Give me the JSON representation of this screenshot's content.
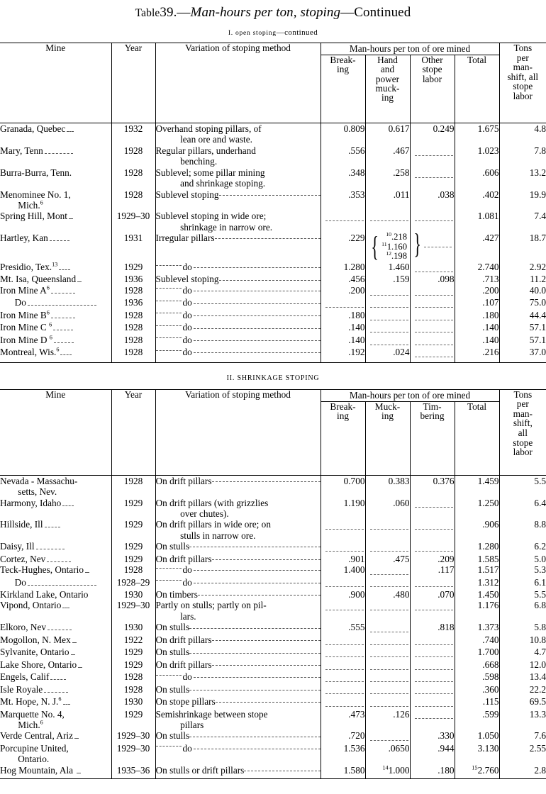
{
  "title": {
    "label_small": "Table",
    "number": "39.—",
    "italic_part": "Man-hours per ton, stoping",
    "suffix": "—Continued"
  },
  "section1": {
    "heading_numeral": "I.",
    "heading_smallcaps": "open stoping",
    "heading_suffix": "—continued"
  },
  "section2": {
    "heading": "II.  SHRINKAGE STOPING"
  },
  "table1": {
    "headers": {
      "mine": "Mine",
      "year": "Year",
      "method": "Variation of stoping method",
      "group": "Man-hours per ton of ore mined",
      "breaking": "Break-\ning",
      "mucking": "Hand\nand\npower\nmuck-\ning",
      "other": "Other\nstope\nlabor",
      "total": "Total",
      "tons": "Tons\nper\nman-\nshift, all\nstope\nlabor"
    },
    "rows": [
      {
        "mine": "Granada, Quebec",
        "mine_leader": true,
        "year": "1932",
        "method": "Overhand stoping pillars, of",
        "method2": "lean ore and waste.",
        "breaking": "0.809",
        "mucking": "0.617",
        "other": "0.249",
        "total": "1.675",
        "tons": "4.8"
      },
      {
        "mine": "Mary, Tenn",
        "mine_leader": true,
        "year": "1928",
        "method": "Regular    pillars,    underhand",
        "method2": "benching.",
        "breaking": ".556",
        "mucking": ".467",
        "other": "",
        "other_dash": true,
        "total": "1.023",
        "tons": "7.8"
      },
      {
        "mine": "Burra-Burra,  Tenn.",
        "mine_leader": false,
        "year": "1928",
        "method": "Sublevel; some pillar mining",
        "method2": "and shrinkage stoping.",
        "breaking": ".348",
        "mucking": ".258",
        "other": "",
        "other_dash": true,
        "total": ".606",
        "tons": "13.2"
      },
      {
        "mine": "Menominee   No.   1,",
        "mine2": "Mich.",
        "mine2_sup": "6",
        "mine_leader": false,
        "year": "1928",
        "method": "Sublevel stoping",
        "method_leader": true,
        "breaking": ".353",
        "mucking": ".011",
        "other": ".038",
        "total": ".402",
        "tons": "19.9"
      },
      {
        "mine": "Spring Hill, Mont",
        "mine_leader": true,
        "year": "1929–30",
        "method": "Sublevel stoping in wide ore;",
        "method2": "shrinkage in narrow ore.",
        "breaking": "",
        "breaking_dash": true,
        "mucking": "",
        "mucking_dash": true,
        "other": "",
        "other_dash": true,
        "total": "1.081",
        "tons": "7.4"
      },
      {
        "mine": "Hartley, Kan",
        "mine_leader": true,
        "year": "1931",
        "method": "Irregular pillars",
        "method_leader": true,
        "breaking": ".229",
        "brace": {
          "v1": ".218",
          "s1": "10",
          "v2": "1.160",
          "s2": "11",
          "v3": ".198",
          "s3": "12"
        },
        "other": "",
        "other_dash": true,
        "total": ".427",
        "tons": "18.7"
      },
      {
        "mine": "Presidio, Tex.",
        "mine_sup": "13",
        "mine_leader": true,
        "year": "1929",
        "method": "do",
        "method_do": true,
        "breaking": "1.280",
        "mucking": "1.460",
        "other": "",
        "other_dash": true,
        "total": "2.740",
        "tons": "2.92"
      },
      {
        "mine": "Mt. Isa, Queensland",
        "mine_leader": true,
        "year": "1936",
        "method": "Sublevel stoping",
        "method_leader": true,
        "breaking": ".456",
        "mucking": ".159",
        "other": ".098",
        "total": ".713",
        "tons": "11.2"
      },
      {
        "mine": "Iron Mine A",
        "mine_sup": "6",
        "mine_leader": true,
        "year": "1928",
        "method": "do",
        "method_do": true,
        "breaking": ".200",
        "mucking": "",
        "mucking_dash": true,
        "other": "",
        "other_dash": true,
        "total": ".200",
        "tons": "40.0"
      },
      {
        "mine": "Do",
        "mine_center": true,
        "mine_leader": true,
        "year": "1936",
        "method": "do",
        "method_do": true,
        "breaking": "",
        "breaking_dash": true,
        "mucking": "",
        "mucking_dash": true,
        "other": "",
        "other_dash": true,
        "total": ".107",
        "tons": "75.0"
      },
      {
        "mine": "Iron Mine B",
        "mine_sup": "6",
        "mine_leader": true,
        "year": "1928",
        "method": "do",
        "method_do": true,
        "breaking": ".180",
        "mucking": "",
        "mucking_dash": true,
        "other": "",
        "other_dash": true,
        "total": ".180",
        "tons": "44.4"
      },
      {
        "mine": "Iron Mine C ",
        "mine_sup": "6",
        "mine_leader": true,
        "year": "1928",
        "method": "do",
        "method_do": true,
        "breaking": ".140",
        "mucking": "",
        "mucking_dash": true,
        "other": "",
        "other_dash": true,
        "total": ".140",
        "tons": "57.1"
      },
      {
        "mine": "Iron Mine D ",
        "mine_sup": "6",
        "mine_leader": true,
        "year": "1928",
        "method": "do",
        "method_do": true,
        "breaking": ".140",
        "mucking": "",
        "mucking_dash": true,
        "other": "",
        "other_dash": true,
        "total": ".140",
        "tons": "57.1"
      },
      {
        "mine": "Montreal, Wis.",
        "mine_sup": "6",
        "mine_leader": true,
        "year": "1928",
        "method": "do",
        "method_do": true,
        "breaking": ".192",
        "mucking": ".024",
        "other": "",
        "other_dash": true,
        "total": ".216",
        "tons": "37.0"
      }
    ]
  },
  "table2": {
    "headers": {
      "mine": "Mine",
      "year": "Year",
      "method": "Variation of stoping method",
      "group": "Man-hours per ton of ore mined",
      "breaking": "Break-\ning",
      "mucking": "Muck-\ning",
      "timbering": "Tim-\nbering",
      "total": "Total",
      "tons": "Tons\nper\nman-\nshift,\nall\nstope\nlabor"
    },
    "rows": [
      {
        "mine": "Nevada - Massachu-",
        "mine2": "setts, Nev.",
        "year": "1928",
        "method": "On drift pillars",
        "method_leader": true,
        "breaking": "0.700",
        "mucking": "0.383",
        "timbering": "0.376",
        "total": "1.459",
        "tons": "5.5"
      },
      {
        "mine": "Harmony, Idaho",
        "mine_leader": true,
        "year": "1929",
        "method": "On drift pillars (with grizzlies",
        "method2": "over chutes).",
        "breaking": "1.190",
        "mucking": ".060",
        "timbering": "",
        "timbering_dash": true,
        "total": "1.250",
        "tons": "6.4"
      },
      {
        "mine": "Hillside, Ill",
        "mine_leader": true,
        "year": "1929",
        "method": "On drift pillars in wide ore; on",
        "method2": "stulls in narrow ore.",
        "breaking": "",
        "breaking_dash": true,
        "mucking": "",
        "mucking_dash": true,
        "timbering": "",
        "timbering_dash": true,
        "total": ".906",
        "tons": "8.8"
      },
      {
        "mine": "Daisy, Ill",
        "mine_leader": true,
        "year": "1929",
        "method": "On stulls",
        "method_leader": true,
        "breaking": "",
        "breaking_dash": true,
        "mucking": "",
        "mucking_dash": true,
        "timbering": "",
        "timbering_dash": true,
        "total": "1.280",
        "tons": "6.2"
      },
      {
        "mine": "Cortez, Nev",
        "mine_leader": true,
        "year": "1929",
        "method": "On drift pillars",
        "method_leader": true,
        "breaking": ".901",
        "mucking": ".475",
        "timbering": ".209",
        "total": "1.585",
        "tons": "5.0"
      },
      {
        "mine": "Teck-Hughes, Ontario",
        "mine_leader": true,
        "year": "1928",
        "method": "do",
        "method_do": true,
        "breaking": "1.400",
        "mucking": "",
        "mucking_dash": true,
        "timbering": ".117",
        "total": "1.517",
        "tons": "5.3"
      },
      {
        "mine": "Do",
        "mine_center": true,
        "mine_leader": true,
        "year": "1928–29",
        "method": "do",
        "method_do": true,
        "breaking": "",
        "breaking_dash": true,
        "mucking": "",
        "mucking_dash": true,
        "timbering": "",
        "timbering_dash": true,
        "total": "1.312",
        "tons": "6.1"
      },
      {
        "mine": "Kirkland Lake, Ontario",
        "year": "1930",
        "method": "On timbers",
        "method_leader": true,
        "breaking": ".900",
        "mucking": ".480",
        "timbering": ".070",
        "total": "1.450",
        "tons": "5.5"
      },
      {
        "mine": "Vipond, Ontario",
        "mine_leader": true,
        "year": "1929–30",
        "method": "Partly on stulls; partly on pil-",
        "method2": "lars.",
        "breaking": "",
        "breaking_dash": true,
        "mucking": "",
        "mucking_dash": true,
        "timbering": "",
        "timbering_dash": true,
        "total": "1.176",
        "tons": "6.8"
      },
      {
        "mine": "Elkoro, Nev",
        "mine_leader": true,
        "year": "1930",
        "method": "On stulls",
        "method_leader": true,
        "breaking": ".555",
        "mucking": "",
        "mucking_dash": true,
        "timbering": ".818",
        "total": "1.373",
        "tons": "5.8"
      },
      {
        "mine": "Mogollon, N. Mex",
        "mine_leader": true,
        "year": "1922",
        "method": "On drift  pillars",
        "method_leader": true,
        "breaking": "",
        "breaking_dash": true,
        "mucking": "",
        "mucking_dash": true,
        "timbering": "",
        "timbering_dash": true,
        "total": ".740",
        "tons": "10.8"
      },
      {
        "mine": "Sylvanite, Ontario",
        "mine_leader": true,
        "year": "1929",
        "method": "On stulls",
        "method_leader": true,
        "breaking": "",
        "breaking_dash": true,
        "mucking": "",
        "mucking_dash": true,
        "timbering": "",
        "timbering_dash": true,
        "total": "1.700",
        "tons": "4.7"
      },
      {
        "mine": "Lake Shore, Ontario",
        "mine_leader": true,
        "year": "1929",
        "method": "On drift pillars",
        "method_leader": true,
        "breaking": "",
        "breaking_dash": true,
        "mucking": "",
        "mucking_dash": true,
        "timbering": "",
        "timbering_dash": true,
        "total": ".668",
        "tons": "12.0"
      },
      {
        "mine": "Engels, Calif",
        "mine_leader": true,
        "year": "1928",
        "method": "do",
        "method_do": true,
        "breaking": "",
        "breaking_dash": true,
        "mucking": "",
        "mucking_dash": true,
        "timbering": "",
        "timbering_dash": true,
        "total": ".598",
        "tons": "13.4"
      },
      {
        "mine": "Isle Royale",
        "mine_leader": true,
        "year": "1928",
        "method": "On stulls",
        "method_leader": true,
        "breaking": "",
        "breaking_dash": true,
        "mucking": "",
        "mucking_dash": true,
        "timbering": "",
        "timbering_dash": true,
        "total": ".360",
        "tons": "22.2"
      },
      {
        "mine": "Mt. Hope, N. J.",
        "mine_sup": "6",
        "mine_leader": true,
        "year": "1930",
        "method": "On stope pillars",
        "method_leader": true,
        "breaking": "",
        "breaking_dash": true,
        "mucking": "",
        "mucking_dash": true,
        "timbering": "",
        "timbering_dash": true,
        "total": ".115",
        "tons": "69.5"
      },
      {
        "mine": "Marquette    No.    4,",
        "mine2": "Mich.",
        "mine2_sup": "6",
        "year": "1929",
        "method": "Semishrinkage between stope",
        "method2": "pillars",
        "breaking": ".473",
        "mucking": ".126",
        "timbering": "",
        "timbering_dash": true,
        "total": ".599",
        "tons": "13.3"
      },
      {
        "mine": "Verde Central, Ariz",
        "mine_leader": true,
        "year": "1929–30",
        "method": "On stulls",
        "method_leader": true,
        "breaking": ".720",
        "mucking": "",
        "mucking_dash": true,
        "timbering": ".330",
        "total": "1.050",
        "tons": "7.6"
      },
      {
        "mine": "Porcupine    United,",
        "mine2": "Ontario.",
        "year": "1929–30",
        "method": "do",
        "method_do": true,
        "breaking": "1.536",
        "mucking": ".0650",
        "timbering": ".944",
        "total": "3.130",
        "tons": "2.55"
      },
      {
        "mine": "Hog Mountain, Ala ",
        "mine_leader": true,
        "year": "1935–36",
        "method": "On stulls or  drift pillars",
        "method_leader": true,
        "breaking": "1.580",
        "mucking": "1.000",
        "mucking_sup": "14",
        "timbering": ".180",
        "total": "2.760",
        "total_sup": "15",
        "tons": "2.8"
      }
    ]
  }
}
